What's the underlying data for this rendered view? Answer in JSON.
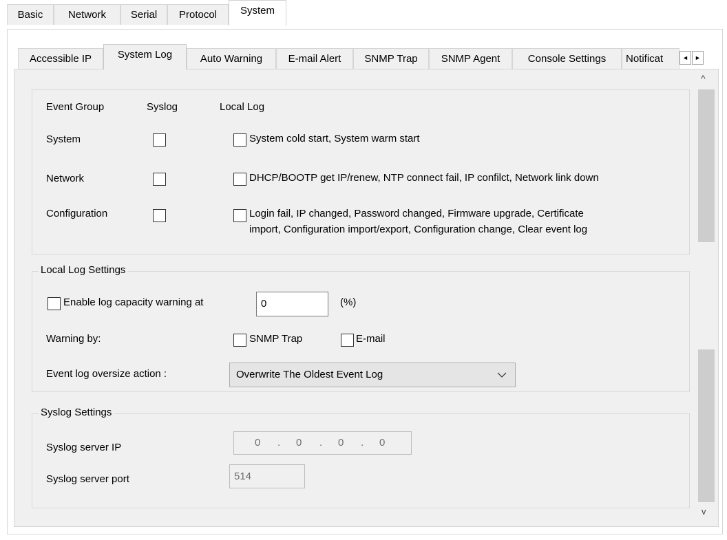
{
  "top_tabs": [
    {
      "label": "Basic",
      "active": false
    },
    {
      "label": "Network",
      "active": false
    },
    {
      "label": "Serial",
      "active": false
    },
    {
      "label": "Protocol",
      "active": false
    },
    {
      "label": "System",
      "active": true
    }
  ],
  "sub_tabs": [
    {
      "label": "Accessible IP",
      "active": false
    },
    {
      "label": "System Log",
      "active": true
    },
    {
      "label": "Auto Warning",
      "active": false
    },
    {
      "label": "E-mail Alert",
      "active": false
    },
    {
      "label": "SNMP Trap",
      "active": false
    },
    {
      "label": "SNMP Agent",
      "active": false
    },
    {
      "label": "Console Settings",
      "active": false
    },
    {
      "label": "Notificat",
      "active": false
    }
  ],
  "tab_scroll": {
    "left": "◄",
    "right": "►"
  },
  "event_groups": {
    "headers": {
      "group": "Event Group",
      "syslog": "Syslog",
      "local_log": "Local Log"
    },
    "rows": [
      {
        "name": "System",
        "syslog_checked": false,
        "local_checked": false,
        "local_text": [
          "System cold start, System warm start"
        ]
      },
      {
        "name": "Network",
        "syslog_checked": false,
        "local_checked": false,
        "local_text": [
          "DHCP/BOOTP get IP/renew, NTP connect fail, IP confilct, Network link down"
        ]
      },
      {
        "name": "Configuration",
        "syslog_checked": false,
        "local_checked": false,
        "local_text": [
          "Login fail, IP changed, Password changed, Firmware upgrade, Certificate",
          "import, Configuration import/export, Configuration change, Clear event log"
        ]
      }
    ]
  },
  "local_log": {
    "title": "Local Log Settings",
    "capacity_label": "Enable log capacity warning at",
    "capacity_checked": false,
    "capacity_value": "0",
    "capacity_unit": "(%)",
    "warning_by_label": "Warning by:",
    "snmp_trap_label": "SNMP Trap",
    "snmp_trap_checked": false,
    "email_label": "E-mail",
    "email_checked": false,
    "oversize_label": "Event log oversize action :",
    "oversize_value": "Overwrite The Oldest Event Log"
  },
  "syslog": {
    "title": "Syslog Settings",
    "server_ip_label": "Syslog server IP",
    "server_ip_octets": [
      "0",
      "0",
      "0",
      "0"
    ],
    "server_ip_dot": ".",
    "server_port_label": "Syslog server port",
    "server_port_value": "514"
  },
  "scrollbar": {
    "up": "^",
    "down": "v",
    "up_thumb_fraction": 0.37,
    "down_thumb_fraction": 0.35
  }
}
